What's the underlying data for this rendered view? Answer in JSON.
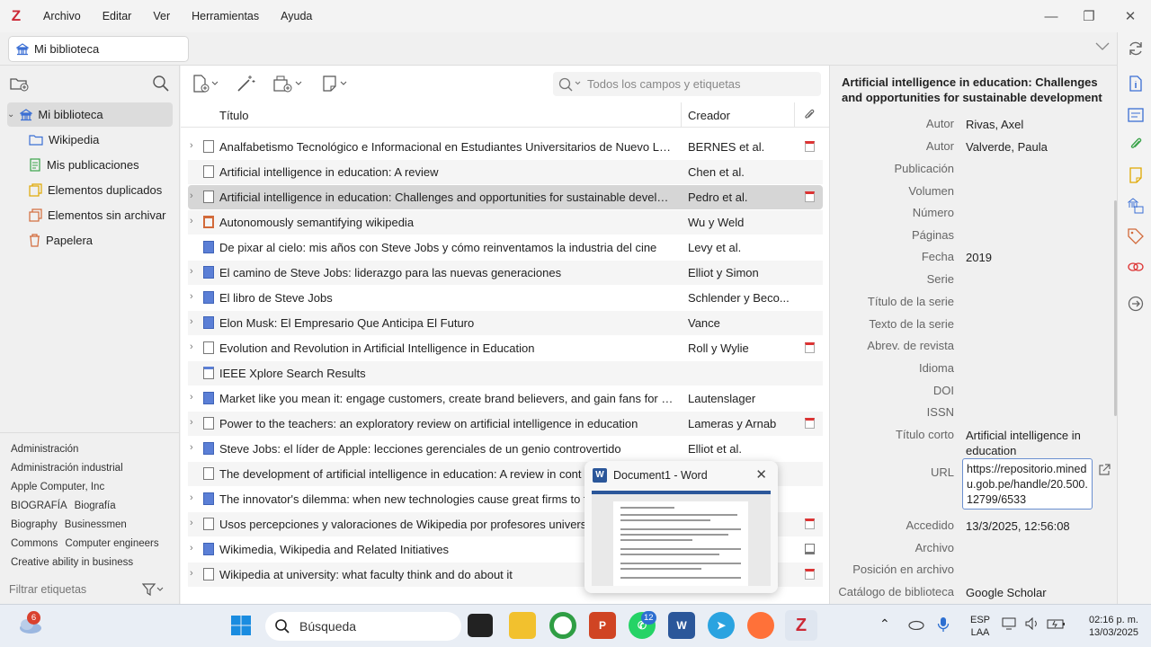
{
  "menubar": {
    "logo": "Z",
    "items": [
      "Archivo",
      "Editar",
      "Ver",
      "Herramientas",
      "Ayuda"
    ],
    "controls": {
      "minimize": "—",
      "restore": "❐",
      "close": "✕"
    }
  },
  "tab": {
    "label": "Mi biblioteca"
  },
  "collections": {
    "items": [
      {
        "label": "Mi biblioteca",
        "icon": "library-icon"
      },
      {
        "label": "Wikipedia",
        "icon": "folder-icon"
      },
      {
        "label": "Mis publicaciones",
        "icon": "publications-icon"
      },
      {
        "label": "Elementos duplicados",
        "icon": "duplicate-icon"
      },
      {
        "label": "Elementos sin archivar",
        "icon": "unfiled-icon"
      },
      {
        "label": "Papelera",
        "icon": "trash-icon"
      }
    ],
    "tags": [
      "Administración",
      "Administración industrial",
      "Apple Computer, Inc",
      "BIOGRAFÍA",
      "Biografía",
      "Biography",
      "Businessmen",
      "Commons",
      "Computer engineers",
      "Creative ability in business"
    ],
    "tag_filter_placeholder": "Filtrar etiquetas"
  },
  "items": {
    "search_placeholder": "Todos los campos y etiquetas",
    "columns": {
      "title": "Título",
      "creator": "Creador"
    },
    "rows": [
      {
        "title": "Analfabetismo Tecnológico e Informacional en Estudiantes Universitarios de Nuevo León",
        "creator": "BERNES et al.",
        "type": "doc",
        "attachment": "pdf",
        "expandable": true
      },
      {
        "title": "Artificial intelligence in education: A review",
        "creator": "Chen et al.",
        "type": "doc",
        "attachment": "",
        "expandable": false
      },
      {
        "title": "Artificial intelligence in education: Challenges and opportunities for sustainable development",
        "creator": "Pedro et al.",
        "type": "doc",
        "attachment": "pdf",
        "expandable": true
      },
      {
        "title": "Autonomously semantifying wikipedia",
        "creator": "Wu y Weld",
        "type": "enc",
        "attachment": "",
        "expandable": true
      },
      {
        "title": "De pixar al cielo: mis años con Steve Jobs y cómo reinventamos la industria del cine",
        "creator": "Levy et al.",
        "type": "book",
        "attachment": "",
        "expandable": false
      },
      {
        "title": "El camino de Steve Jobs: liderazgo para las nuevas generaciones",
        "creator": "Elliot y Simon",
        "type": "book",
        "attachment": "",
        "expandable": true
      },
      {
        "title": "El libro de Steve Jobs",
        "creator": "Schlender y Beco...",
        "type": "book",
        "attachment": "",
        "expandable": true
      },
      {
        "title": "Elon Musk: El Empresario Que Anticipa El Futuro",
        "creator": "Vance",
        "type": "book",
        "attachment": "",
        "expandable": true
      },
      {
        "title": "Evolution and Revolution in Artificial Intelligence in Education",
        "creator": "Roll y Wylie",
        "type": "doc",
        "attachment": "pdf",
        "expandable": true
      },
      {
        "title": "IEEE Xplore Search Results",
        "creator": "",
        "type": "web",
        "attachment": "",
        "expandable": false
      },
      {
        "title": "Market like you mean it: engage customers, create brand believers, and gain fans for ever",
        "creator": "Lautenslager",
        "type": "book",
        "attachment": "",
        "expandable": true
      },
      {
        "title": "Power to the teachers: an exploratory review on artificial intelligence in education",
        "creator": "Lameras y Arnab",
        "type": "doc",
        "attachment": "pdf",
        "expandable": true
      },
      {
        "title": "Steve Jobs: el líder de Apple: lecciones gerenciales de un genio controvertido",
        "creator": "Elliot et al.",
        "type": "book",
        "attachment": "",
        "expandable": true
      },
      {
        "title": "The development of artificial intelligence in education: A review in cont",
        "creator": "",
        "type": "doc",
        "attachment": "",
        "expandable": false
      },
      {
        "title": "The innovator's dilemma: when new technologies cause great firms to f",
        "creator": "",
        "type": "book",
        "attachment": "",
        "expandable": true
      },
      {
        "title": "Usos percepciones y valoraciones de Wikipedia por profesores universi",
        "creator": "",
        "type": "doc",
        "attachment": "pdf",
        "expandable": true
      },
      {
        "title": "Wikimedia, Wikipedia and Related Initiatives",
        "creator": "",
        "type": "bookopen",
        "attachment": "snapshot",
        "expandable": true
      },
      {
        "title": "Wikipedia at university: what faculty think and do about it",
        "creator": "",
        "type": "doc",
        "attachment": "pdf",
        "expandable": true
      }
    ]
  },
  "word_thumbnail": {
    "title": "Document1 - Word",
    "icon_letter": "W"
  },
  "itempane": {
    "title": "Artificial intelligence in education: Challenges and opportunities for sustainable development",
    "fields": [
      {
        "label": "Autor",
        "value": "Rivas, Axel"
      },
      {
        "label": "Autor",
        "value": "Valverde, Paula"
      },
      {
        "label": "Publicación",
        "value": ""
      },
      {
        "label": "Volumen",
        "value": ""
      },
      {
        "label": "Número",
        "value": ""
      },
      {
        "label": "Páginas",
        "value": ""
      },
      {
        "label": "Fecha",
        "value": "2019"
      },
      {
        "label": "Serie",
        "value": ""
      },
      {
        "label": "Título de la serie",
        "value": ""
      },
      {
        "label": "Texto de la serie",
        "value": ""
      },
      {
        "label": "Abrev. de revista",
        "value": ""
      },
      {
        "label": "Idioma",
        "value": ""
      },
      {
        "label": "DOI",
        "value": ""
      },
      {
        "label": "ISSN",
        "value": ""
      },
      {
        "label": "Título corto",
        "value": "Artificial intelligence in education"
      },
      {
        "label": "URL",
        "value": "https://repositorio.minedu.gob.pe/handle/20.500.12799/6533"
      },
      {
        "label": "Accedido",
        "value": "13/3/2025, 12:56:08"
      },
      {
        "label": "Archivo",
        "value": ""
      },
      {
        "label": "Posición en archivo",
        "value": ""
      },
      {
        "label": "Catálogo de biblioteca",
        "value": "Google Scholar"
      }
    ]
  },
  "taskbar": {
    "weather_badge": "6",
    "search_label": "Búsqueda",
    "whatsapp_badge": "12",
    "lang_line1": "ESP",
    "lang_line2": "LAA",
    "time": "02:16 p. m.",
    "date": "13/03/2025"
  },
  "colors": {
    "accent": "#cc2936",
    "selection": "#d6d6d6",
    "link_blue": "#3b6fd4"
  }
}
